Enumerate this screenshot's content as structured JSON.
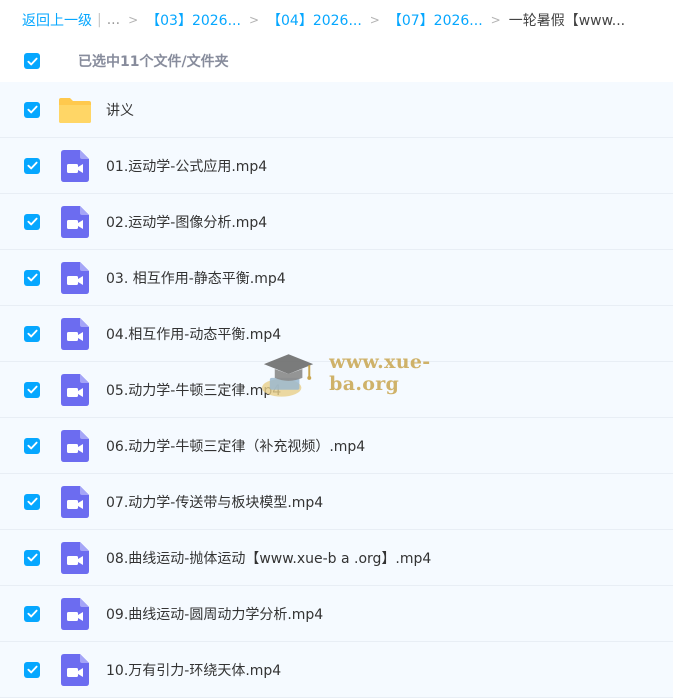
{
  "breadcrumb": {
    "back": "返回上一级",
    "pipe": "|",
    "ellipsis": "...",
    "separator": ">",
    "crumbs": [
      "【03】2026...",
      "【04】2026...",
      "【07】2026..."
    ],
    "current": "一轮暑假【www..."
  },
  "selection": {
    "label": "已选中11个文件/文件夹"
  },
  "files": [
    {
      "name": "讲义",
      "type": "folder"
    },
    {
      "name": "01.运动学-公式应用.mp4",
      "type": "video"
    },
    {
      "name": "02.运动学-图像分析.mp4",
      "type": "video"
    },
    {
      "name": "03. 相互作用-静态平衡.mp4",
      "type": "video"
    },
    {
      "name": "04.相互作用-动态平衡.mp4",
      "type": "video"
    },
    {
      "name": "05.动力学-牛顿三定律.mp4",
      "type": "video"
    },
    {
      "name": "06.动力学-牛顿三定律（补充视频）.mp4",
      "type": "video"
    },
    {
      "name": "07.动力学-传送带与板块模型.mp4",
      "type": "video"
    },
    {
      "name": "08.曲线运动-抛体运动【www.xue-b a .org】.mp4",
      "type": "video"
    },
    {
      "name": "09.曲线运动-圆周动力学分析.mp4",
      "type": "video"
    },
    {
      "name": "10.万有引力-环绕天体.mp4",
      "type": "video"
    }
  ],
  "watermark": {
    "text": "www.xue-ba.org"
  },
  "colors": {
    "accent": "#06a7ff",
    "folder": "#ffc94d",
    "video": "#6c6cf0"
  }
}
